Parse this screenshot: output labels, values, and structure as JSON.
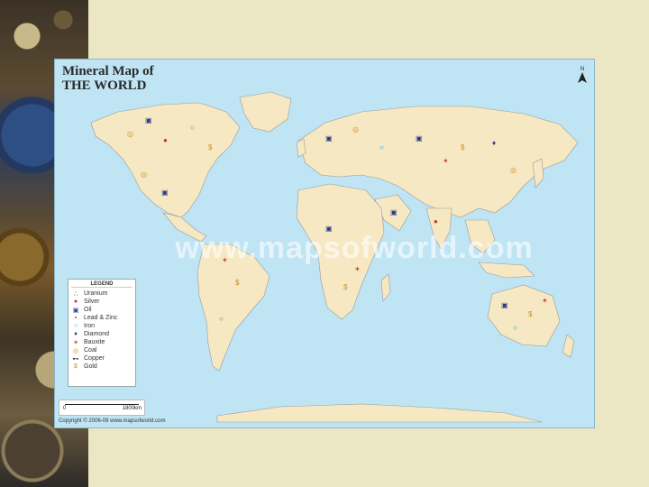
{
  "map": {
    "title_line1": "Mineral Map of",
    "title_line2": "THE WORLD",
    "north_label": "N",
    "watermark": "www.mapsofworld.com",
    "copyright": "Copyright © 2006-09 www.mapsofworld.com",
    "scale": {
      "zero": "0",
      "label": "1800km"
    },
    "colors": {
      "ocean": "#bfe4f3",
      "land": "#f6e8c2",
      "border": "#9b9b9b"
    }
  },
  "legend": {
    "title": "LEGEND",
    "items": [
      {
        "label": "Uranium",
        "symbol": "∴",
        "color": "#444444",
        "icon": "uranium-icon"
      },
      {
        "label": "Silver",
        "symbol": "●",
        "color": "#c0392b",
        "icon": "silver-icon"
      },
      {
        "label": "Oil",
        "symbol": "▣",
        "color": "#2b3a8c",
        "icon": "oil-icon"
      },
      {
        "label": "Lead & Zinc",
        "symbol": "▪",
        "color": "#c0392b",
        "icon": "lead-zinc-icon"
      },
      {
        "label": "Iron",
        "symbol": "○",
        "color": "#1a8fc9",
        "icon": "iron-icon"
      },
      {
        "label": "Diamond",
        "symbol": "♦",
        "color": "#2b3a8c",
        "icon": "diamond-icon"
      },
      {
        "label": "Bauxite",
        "symbol": "✶",
        "color": "#c0392b",
        "icon": "bauxite-icon"
      },
      {
        "label": "Coal",
        "symbol": "◎",
        "color": "#c8902a",
        "icon": "coal-icon"
      },
      {
        "label": "Copper",
        "symbol": "⊷",
        "color": "#222222",
        "icon": "copper-icon"
      },
      {
        "label": "Gold",
        "symbol": "$",
        "color": "#c8902a",
        "icon": "gold-icon"
      }
    ]
  }
}
